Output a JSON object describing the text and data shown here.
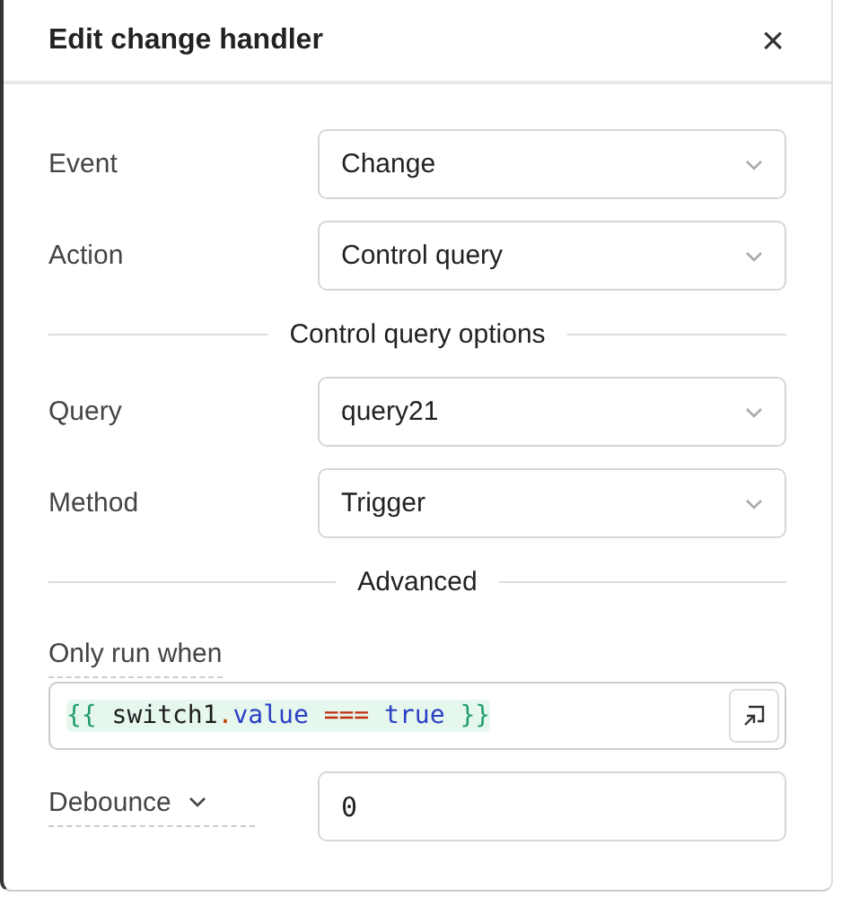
{
  "dialog": {
    "title": "Edit change handler",
    "close_icon": "×"
  },
  "sections": [
    {
      "rows": [
        {
          "label": "Event",
          "value": "Change"
        },
        {
          "label": "Action",
          "value": "Control query"
        }
      ]
    },
    {
      "heading": "Control query options",
      "rows": [
        {
          "label": "Query",
          "value": "query21"
        },
        {
          "label": "Method",
          "value": "Trigger"
        }
      ]
    }
  ],
  "advanced": {
    "heading": "Advanced",
    "condition_label": "Only run when",
    "code": [
      {
        "kind": "brace",
        "text": "{{"
      },
      {
        "kind": "ident",
        "text": " switch1"
      },
      {
        "kind": "dot",
        "text": "."
      },
      {
        "kind": "prop",
        "text": "value"
      },
      {
        "kind": "op",
        "text": " ==="
      },
      {
        "kind": "keyword",
        "text": " true"
      },
      {
        "kind": "brace",
        "text": " }}"
      }
    ],
    "debounce_label": "Debounce",
    "debounce_value": "0"
  }
}
